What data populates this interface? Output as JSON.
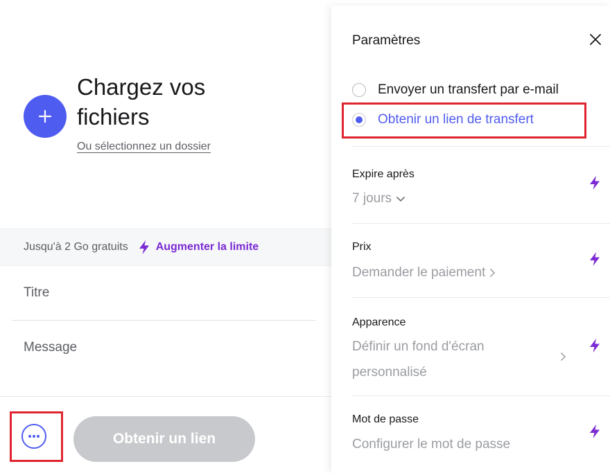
{
  "upload": {
    "title": "Chargez vos fichiers",
    "folder_link": "Ou sélectionnez un dossier"
  },
  "limit": {
    "text": "Jusqu'à 2 Go gratuits",
    "upgrade_link": "Augmenter la limite"
  },
  "form": {
    "title_placeholder": "Titre",
    "message_placeholder": "Message",
    "submit_label": "Obtenir un lien"
  },
  "settings": {
    "title": "Paramètres",
    "transfer_options": [
      {
        "label": "Envoyer un transfert par e-mail",
        "checked": false
      },
      {
        "label": "Obtenir un lien de transfert",
        "checked": true
      }
    ],
    "expiry": {
      "label": "Expire après",
      "value": "7 jours"
    },
    "price": {
      "label": "Prix",
      "value": "Demander le paiement"
    },
    "appearance": {
      "label": "Apparence",
      "value_line1": "Définir un fond d'écran",
      "value_line2": "personnalisé"
    },
    "password": {
      "label": "Mot de passe",
      "value": "Configurer le mot de passe"
    }
  },
  "colors": {
    "accent": "#4f5cf0",
    "premium": "#7b2ad4",
    "highlight": "#e0242f",
    "disabled_button": "#c8c9cc"
  },
  "icons": {
    "upload": "plus-icon",
    "premium": "lightning-bolt-icon",
    "more": "ellipsis-icon",
    "close": "close-icon",
    "dropdown": "chevron-down-icon",
    "navigate": "chevron-right-icon"
  }
}
